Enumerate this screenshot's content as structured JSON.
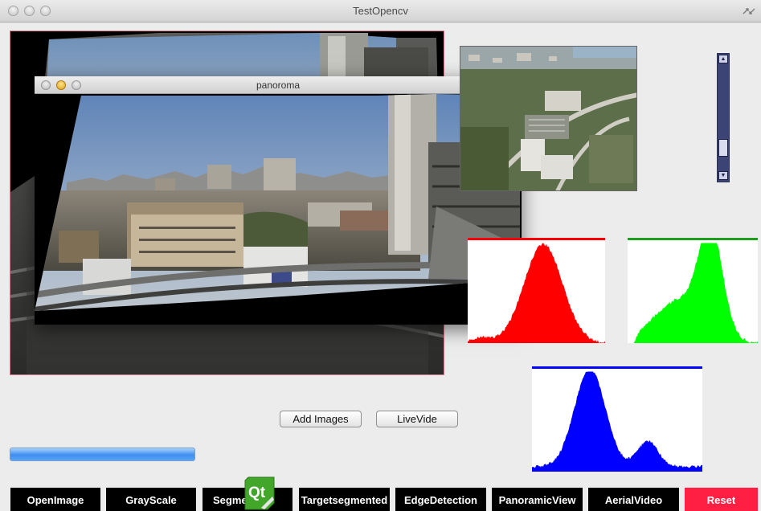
{
  "window": {
    "title": "TestOpencv"
  },
  "panorama_window": {
    "title": "panoroma"
  },
  "buttons": {
    "add_images": "Add Images",
    "live_video": "LiveVide"
  },
  "progress": {
    "fraction": 1.0
  },
  "toolbar": [
    {
      "label": "OpenImage",
      "name": "open-image-button"
    },
    {
      "label": "GrayScale",
      "name": "gray-scale-button"
    },
    {
      "label": "Segme",
      "name": "segmented-button"
    },
    {
      "label": "Targetsegmented",
      "name": "target-segmented-button"
    },
    {
      "label": "EdgeDetection",
      "name": "edge-detection-button"
    },
    {
      "label": "PanoramicView",
      "name": "panoramic-view-button"
    },
    {
      "label": "AerialVideo",
      "name": "aerial-video-button"
    },
    {
      "label": "Reset",
      "name": "reset-button"
    }
  ],
  "histograms": [
    {
      "channel": "red",
      "color": "#ff0000"
    },
    {
      "channel": "green",
      "color": "#00ff00"
    },
    {
      "channel": "blue",
      "color": "#0000ff"
    }
  ],
  "icons": [
    "qt-logo-icon",
    "scroll-up-arrow-icon",
    "scroll-down-arrow-icon"
  ]
}
